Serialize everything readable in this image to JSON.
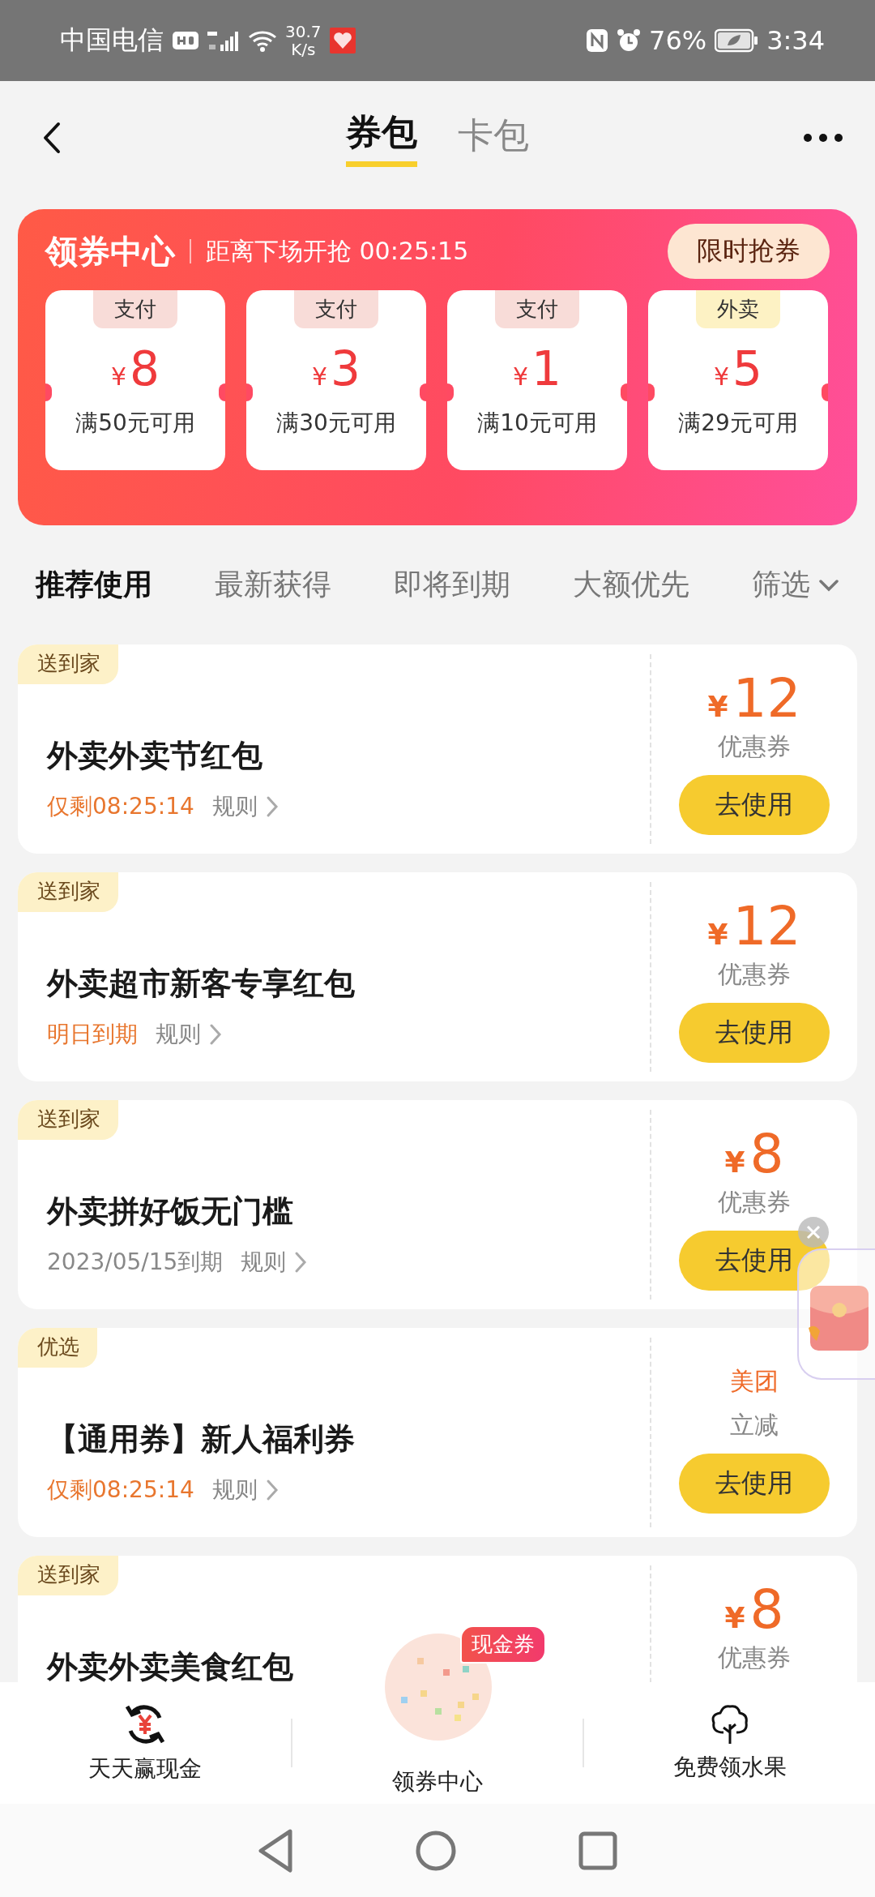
{
  "status_bar": {
    "carrier": "中国电信",
    "speed_value": "30.7",
    "speed_unit": "K/s",
    "battery": "76%",
    "time": "3:34"
  },
  "header": {
    "tabs": [
      {
        "label": "券包",
        "selected": true
      },
      {
        "label": "卡包",
        "selected": false
      }
    ]
  },
  "banner": {
    "title": "领券中心",
    "countdown": "距离下场开抢 00:25:15",
    "button": "限时抢券",
    "coupons": [
      {
        "tag": "支付",
        "color": "#f8dcd8",
        "currency": "¥",
        "amount": "8",
        "condition": "满50元可用"
      },
      {
        "tag": "支付",
        "color": "#f8dcd8",
        "currency": "¥",
        "amount": "3",
        "condition": "满30元可用"
      },
      {
        "tag": "支付",
        "color": "#f8dcd8",
        "currency": "¥",
        "amount": "1",
        "condition": "满10元可用"
      },
      {
        "tag": "外卖",
        "color": "#fdf2c4",
        "currency": "¥",
        "amount": "5",
        "condition": "满29元可用"
      }
    ]
  },
  "sort_tabs": [
    {
      "label": "推荐使用",
      "selected": true,
      "kind": "text"
    },
    {
      "label": "最新获得",
      "selected": false,
      "kind": "text"
    },
    {
      "label": "即将到期",
      "selected": false,
      "kind": "text"
    },
    {
      "label": "大额优先",
      "selected": false,
      "kind": "text"
    },
    {
      "label": "筛选",
      "selected": false,
      "kind": "dropdown"
    }
  ],
  "coupons": [
    {
      "tag": "送到家",
      "title": "外卖外卖节红包",
      "expiry": "仅剩08:25:14",
      "urgent": true,
      "rules": "规则",
      "value": {
        "kind": "amount",
        "currency": "¥",
        "amount": "12",
        "label": "优惠券"
      },
      "button": "去使用"
    },
    {
      "tag": "送到家",
      "title": "外卖超市新客专享红包",
      "expiry": "明日到期",
      "urgent": true,
      "rules": "规则",
      "value": {
        "kind": "amount",
        "currency": "¥",
        "amount": "12",
        "label": "优惠券"
      },
      "button": "去使用"
    },
    {
      "tag": "送到家",
      "title": "外卖拼好饭无门槛",
      "expiry": "2023/05/15到期",
      "urgent": false,
      "rules": "规则",
      "value": {
        "kind": "amount",
        "currency": "¥",
        "amount": "8",
        "label": "优惠券"
      },
      "button": "去使用"
    },
    {
      "tag": "优选",
      "title": "【通用券】新人福利券",
      "expiry": "仅剩08:25:14",
      "urgent": true,
      "rules": "规则",
      "value": {
        "kind": "brand",
        "brand": "美团",
        "label": "立减"
      },
      "button": "去使用"
    },
    {
      "tag": "送到家",
      "title": "外卖外卖美食红包",
      "value": {
        "kind": "amount",
        "currency": "¥",
        "amount": "8",
        "label": "优惠券"
      }
    }
  ],
  "bottom_nav": [
    {
      "label": "天天赢现金",
      "kind": "cash"
    },
    {
      "label": "领券中心",
      "kind": "featured",
      "badge": "现金券"
    },
    {
      "label": "免费领水果",
      "kind": "tree"
    }
  ]
}
